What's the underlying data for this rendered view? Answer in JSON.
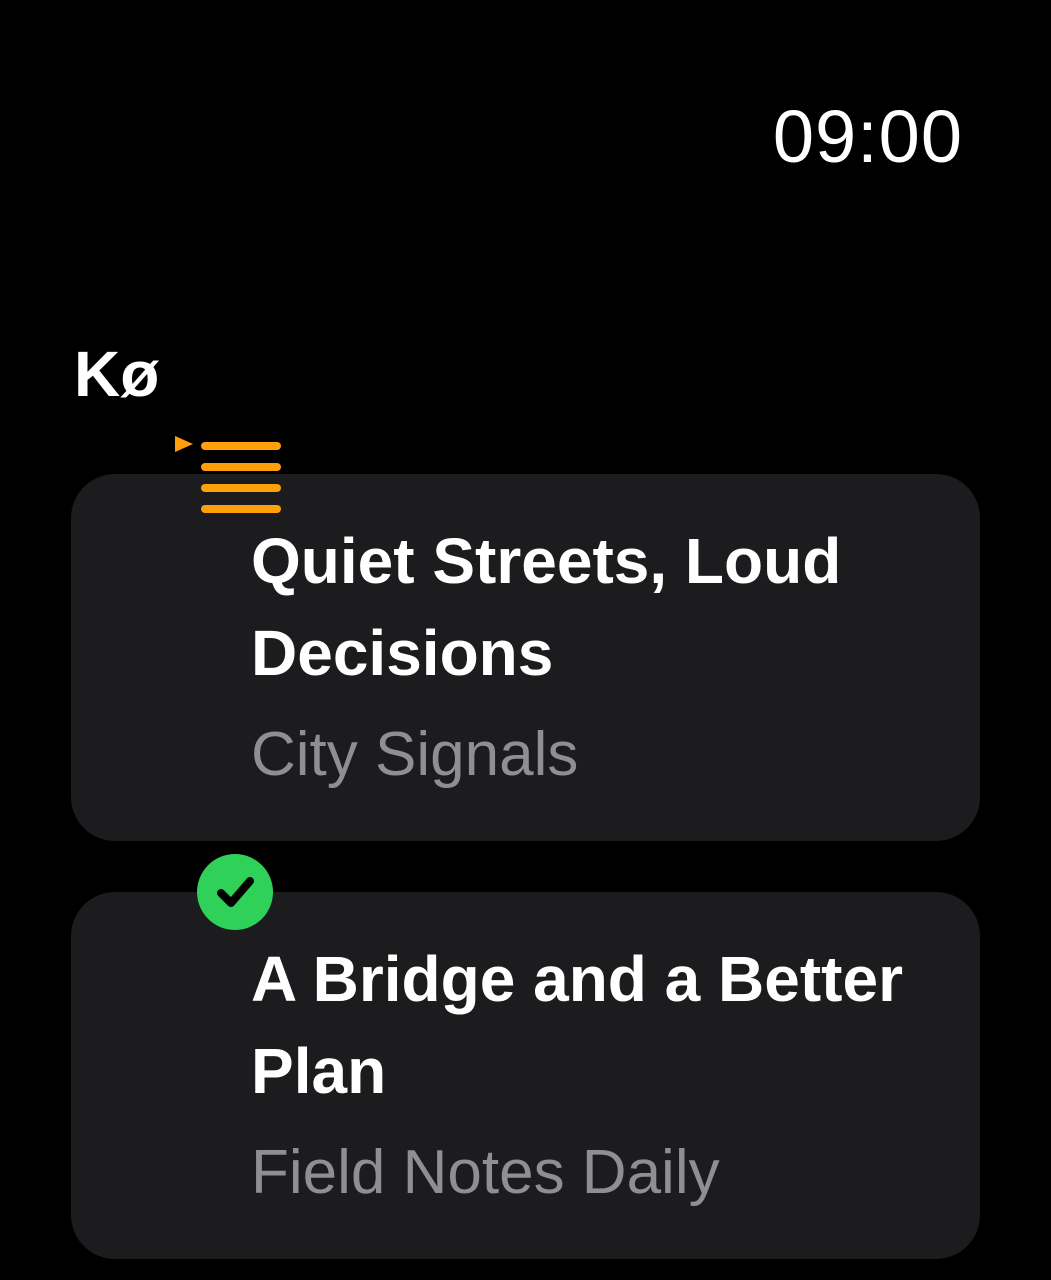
{
  "status": {
    "time": "09:00"
  },
  "header": {
    "title": "Kø"
  },
  "queue": {
    "items": [
      {
        "title": "Quiet Streets, Loud Decisions",
        "show": "City Signals",
        "state_icon": "now-playing-queue-icon"
      },
      {
        "title": "A Bridge and a Better Plan",
        "show": "Field Notes Daily",
        "state_icon": "checkmark-circle-icon"
      }
    ]
  },
  "colors": {
    "background": "#000000",
    "card": "#1c1c1e",
    "accent_playing": "#ff9f0a",
    "accent_done": "#30d158",
    "secondary_text": "#8e8e93"
  }
}
